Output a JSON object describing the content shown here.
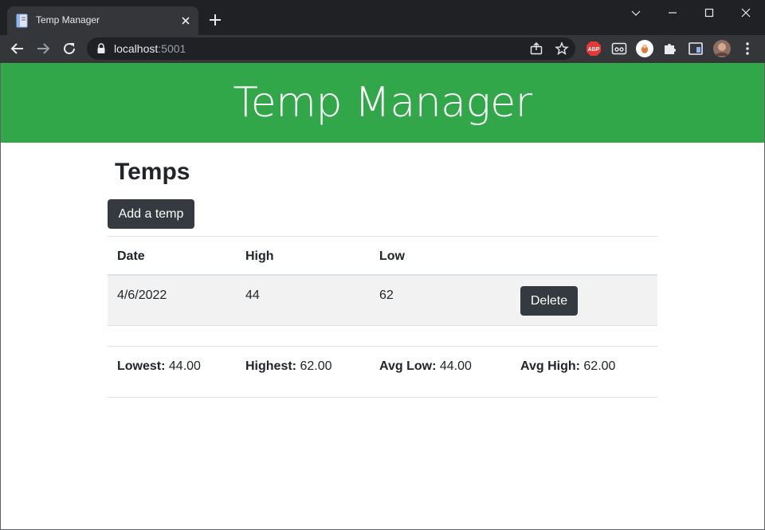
{
  "browser": {
    "tab_title": "Temp Manager",
    "url_host": "localhost",
    "url_port": ":5001"
  },
  "app": {
    "title": "Temp Manager",
    "header_color": "#31a74a"
  },
  "page": {
    "heading": "Temps",
    "add_button": "Add a temp"
  },
  "table": {
    "columns": [
      "Date",
      "High",
      "Low"
    ],
    "rows": [
      {
        "date": "4/6/2022",
        "high": "44",
        "low": "62",
        "action": "Delete"
      }
    ]
  },
  "stats": {
    "lowest_label": "Lowest:",
    "lowest_value": "44.00",
    "highest_label": "Highest:",
    "highest_value": "62.00",
    "avg_low_label": "Avg Low:",
    "avg_low_value": "44.00",
    "avg_high_label": "Avg High:",
    "avg_high_value": "62.00"
  },
  "icons": {
    "tab_favicon": "page-icon",
    "tab_close": "close-icon",
    "new_tab": "plus-icon",
    "back": "arrow-left-icon",
    "forward": "arrow-right-icon",
    "reload": "reload-icon",
    "lock": "lock-icon",
    "share": "share-icon",
    "bookmark": "star-icon",
    "adblock": "abp-icon",
    "extensions": "puzzle-icon",
    "menu": "kebab-menu-icon"
  },
  "adblock_label": "ABP"
}
